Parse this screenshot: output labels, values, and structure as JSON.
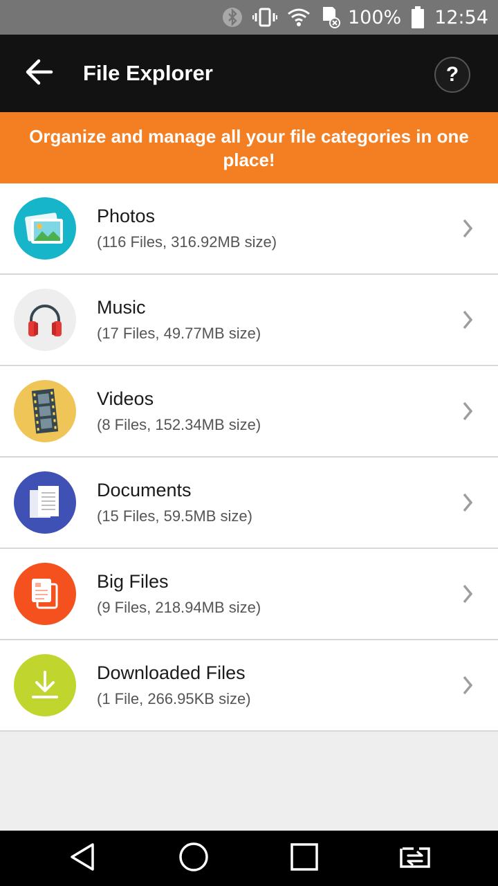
{
  "status_bar": {
    "battery": "100%",
    "time": "12:54",
    "icons": [
      "bluetooth-icon",
      "vibrate-icon",
      "wifi-icon",
      "sd-card-icon",
      "battery-icon"
    ]
  },
  "app_bar": {
    "title": "File Explorer",
    "back_icon": "arrow-left-icon",
    "help_label": "?"
  },
  "banner": {
    "text": "Organize and manage all your file categories in one place!",
    "color": "#f37f22"
  },
  "categories": [
    {
      "name": "Photos",
      "meta": "(116 Files, 316.92MB size)",
      "icon": "photos-icon",
      "color": "#17b5c9"
    },
    {
      "name": "Music",
      "meta": "(17 Files, 49.77MB size)",
      "icon": "headphones-icon",
      "color": "#eeeeee"
    },
    {
      "name": "Videos",
      "meta": "(8 Files, 152.34MB size)",
      "icon": "film-icon",
      "color": "#f0c558"
    },
    {
      "name": "Documents",
      "meta": "(15 Files, 59.5MB size)",
      "icon": "documents-icon",
      "color": "#3f51b5"
    },
    {
      "name": "Big Files",
      "meta": "(9 Files, 218.94MB size)",
      "icon": "big-files-icon",
      "color": "#f4511e"
    },
    {
      "name": "Downloaded Files",
      "meta": "(1 File, 266.95KB size)",
      "icon": "download-icon",
      "color": "#c0d62f"
    }
  ],
  "nav_bar": {
    "icons": [
      "back-triangle-icon",
      "home-circle-icon",
      "recents-square-icon",
      "switch-app-icon"
    ]
  }
}
